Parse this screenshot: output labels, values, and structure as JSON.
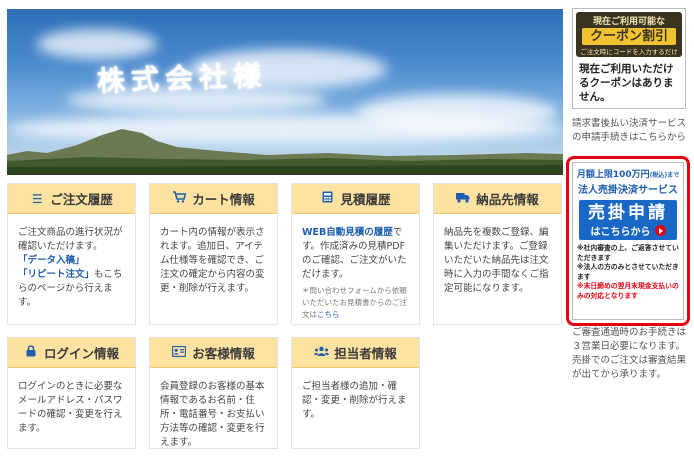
{
  "hero": {
    "sky_text": "株式会社様"
  },
  "cards": [
    {
      "icon": "list-icon",
      "title": "ご注文履歴",
      "lines": [
        "ご注文商品の進行状況が",
        "確認いただけます。"
      ],
      "links": [
        "「データ入稿」",
        "「リピート注文」"
      ],
      "after_link": "もこち",
      "tail": "らのページから行えます。"
    },
    {
      "icon": "cart-icon",
      "title": "カート情報",
      "text": "カート内の情報が表示されます。追加日、アイテム仕様等を確認でき、ご注文の確定から内容の変更・削除が行えます。"
    },
    {
      "icon": "calculator-icon",
      "title": "見積履歴",
      "link": "WEB自動見積の履歴",
      "text": "です。作成済みの見積PDFのご確認、ご注文がいただけます。",
      "note": "＊問い合わせフォームから依頼いただいたお見積書からのご注文は",
      "note_link": "こちら"
    },
    {
      "icon": "truck-icon",
      "title": "納品先情報",
      "text": "納品先を複数ご登録、編集いただけます。ご登録いただいた納品先は注文時に入力の手間なくご指定可能になります。"
    },
    {
      "icon": "lock-icon",
      "title": "ログイン情報",
      "text": "ログインのときに必要なメールアドレス・パスワードの確認・変更を行えます。"
    },
    {
      "icon": "id-card-icon",
      "title": "お客様情報",
      "text": "会員登録のお客様の基本情報であるお名前・住所・電話番号・お支払い方法等の確認・変更を行えます。"
    },
    {
      "icon": "users-icon",
      "title": "担当者情報",
      "text": "ご担当者様の追加・確認・変更・削除が行えます。"
    }
  ],
  "coupon": {
    "label_top": "現在ご利用可能な",
    "label_main": "クーポン割引",
    "label_sub": "ご注文時にコードを入力するだけ",
    "message": "現在ご利用いただけるクーポンはありません。"
  },
  "sidebar": {
    "invoice_text": "請求書後払い決済サービスの申請手続きはこちらから",
    "bottom_text": "ご審査通過時のお手続きは３営業日必要になります。売掛でのご注文は審査結果が出てから承ります。"
  },
  "payment_banner": {
    "line1": "月額上限100万円",
    "line1_small": "(税込)まで",
    "line2": "法人売掛決済サービス",
    "button_main": "売掛申請",
    "button_sub": "はこちらから",
    "note1": "※社内審査の上、ご返答させていただきます",
    "note2": "※法人の方のみとさせていただきます",
    "note3": "※末日締めの翌月末現金支払いのみの対応となります"
  },
  "colors": {
    "card_header": "#fde2a1",
    "link_blue": "#1d5fae",
    "alert_red": "#e60012"
  }
}
